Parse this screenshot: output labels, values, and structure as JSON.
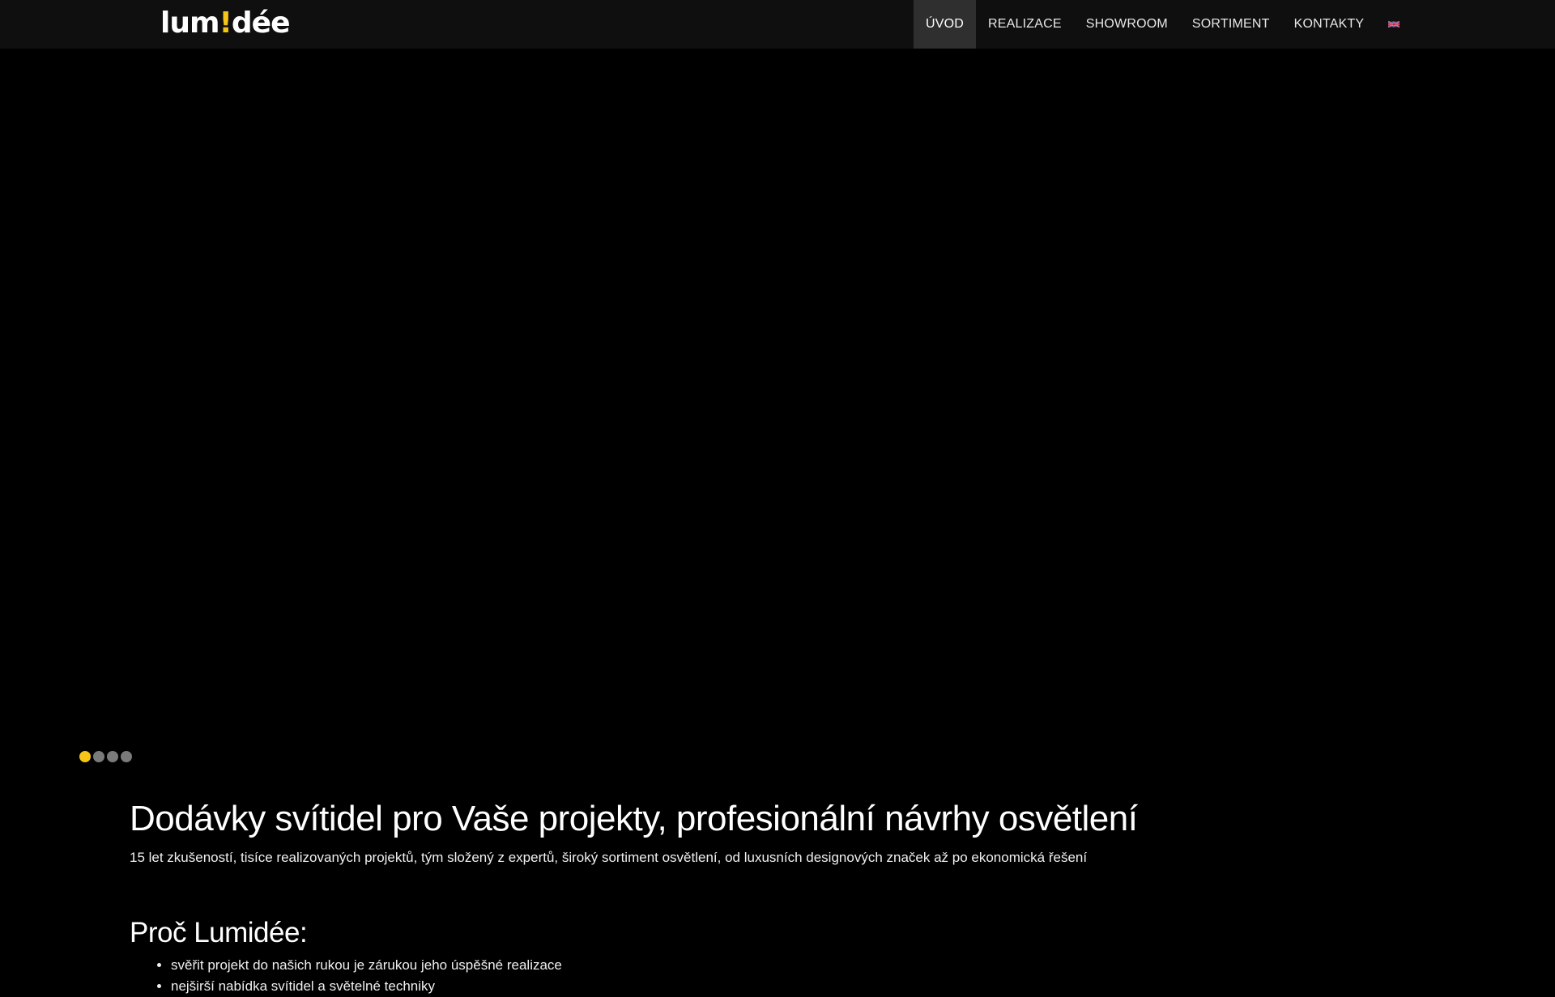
{
  "header": {
    "logo": {
      "prefix": "lum",
      "mark": "!",
      "suffix": "dée"
    },
    "nav": [
      {
        "label": "ÚVOD",
        "active": true
      },
      {
        "label": "REALIZACE",
        "active": false
      },
      {
        "label": "SHOWROOM",
        "active": false
      },
      {
        "label": "SORTIMENT",
        "active": false
      },
      {
        "label": "KONTAKTY",
        "active": false
      }
    ],
    "language_icon": "uk-flag-icon"
  },
  "slider": {
    "dots": [
      {
        "active": true
      },
      {
        "active": false
      },
      {
        "active": false
      },
      {
        "active": false
      }
    ]
  },
  "main": {
    "headline": "Dodávky svítidel pro Vaše projekty, profesionální návrhy osvětlení",
    "subline": "15 let zkušeností, tisíce realizovaných projektů, tým složený z expertů, široký sortiment osvětlení, od luxusních designových značek až po ekonomická řešení",
    "why_title": "Proč Lumidée:",
    "why_items": [
      "svěřit projekt do našich rukou je zárukou jeho úspěšné realizace",
      "nejširší nabídka svítidel a světelné techniky"
    ]
  },
  "colors": {
    "accent": "#f5c518",
    "topbar": "#0f0f0f",
    "active_nav": "#2f2f2f",
    "background": "#000000"
  }
}
